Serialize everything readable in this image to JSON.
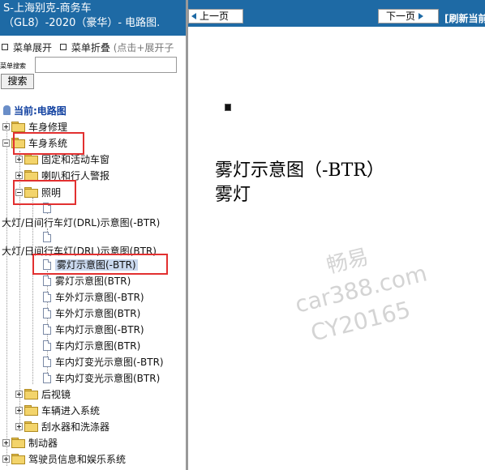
{
  "sidebar": {
    "header_line1": "S-上海别克-商务车",
    "header_line2": "（GL8）-2020（豪华）- 电路图.",
    "expand_menu": "菜单展开",
    "collapse_menu": "菜单折叠",
    "collapse_hint": "(点击+展开子",
    "search_label": "菜单搜索",
    "search_value": "",
    "search_button": "搜索",
    "current": "当前:电路图",
    "tree": {
      "body_repair": "车身修理",
      "body_system": "车身系统",
      "fixed_windows": "固定和活动车窗",
      "horn_alarm": "喇叭和行人警报",
      "lighting": "照明",
      "drl_btr_minus": "大灯/日间行车灯(DRL)示意图(-BTR)",
      "drl_btr": "大灯/日间行车灯(DRL)示意图(BTR)",
      "fog_btr_minus": "雾灯示意图(-BTR)",
      "fog_btr": "雾灯示意图(BTR)",
      "ext_btr_minus": "车外灯示意图(-BTR)",
      "ext_btr": "车外灯示意图(BTR)",
      "int_btr_minus": "车内灯示意图(-BTR)",
      "int_btr": "车内灯示意图(BTR)",
      "dim_btr_minus": "车内灯变光示意图(-BTR)",
      "dim_btr": "车内灯变光示意图(BTR)",
      "mirrors": "后视镜",
      "entry": "车辆进入系统",
      "wipers": "刮水器和洗涤器",
      "brakes": "制动器",
      "infotainment": "驾驶员信息和娱乐系统"
    }
  },
  "content": {
    "prev_button": "上一页",
    "next_button": "下一页",
    "refresh": "[刷新当前",
    "title": "雾灯示意图（-BTR）",
    "subtitle": "雾灯",
    "watermark_line1": "畅易",
    "watermark_line2": "car388.com",
    "watermark_line3": "CY20165"
  },
  "colors": {
    "header_blue": "#1e6aa5",
    "highlight_red": "#e23030",
    "selected_bg": "#c9d8ee"
  }
}
